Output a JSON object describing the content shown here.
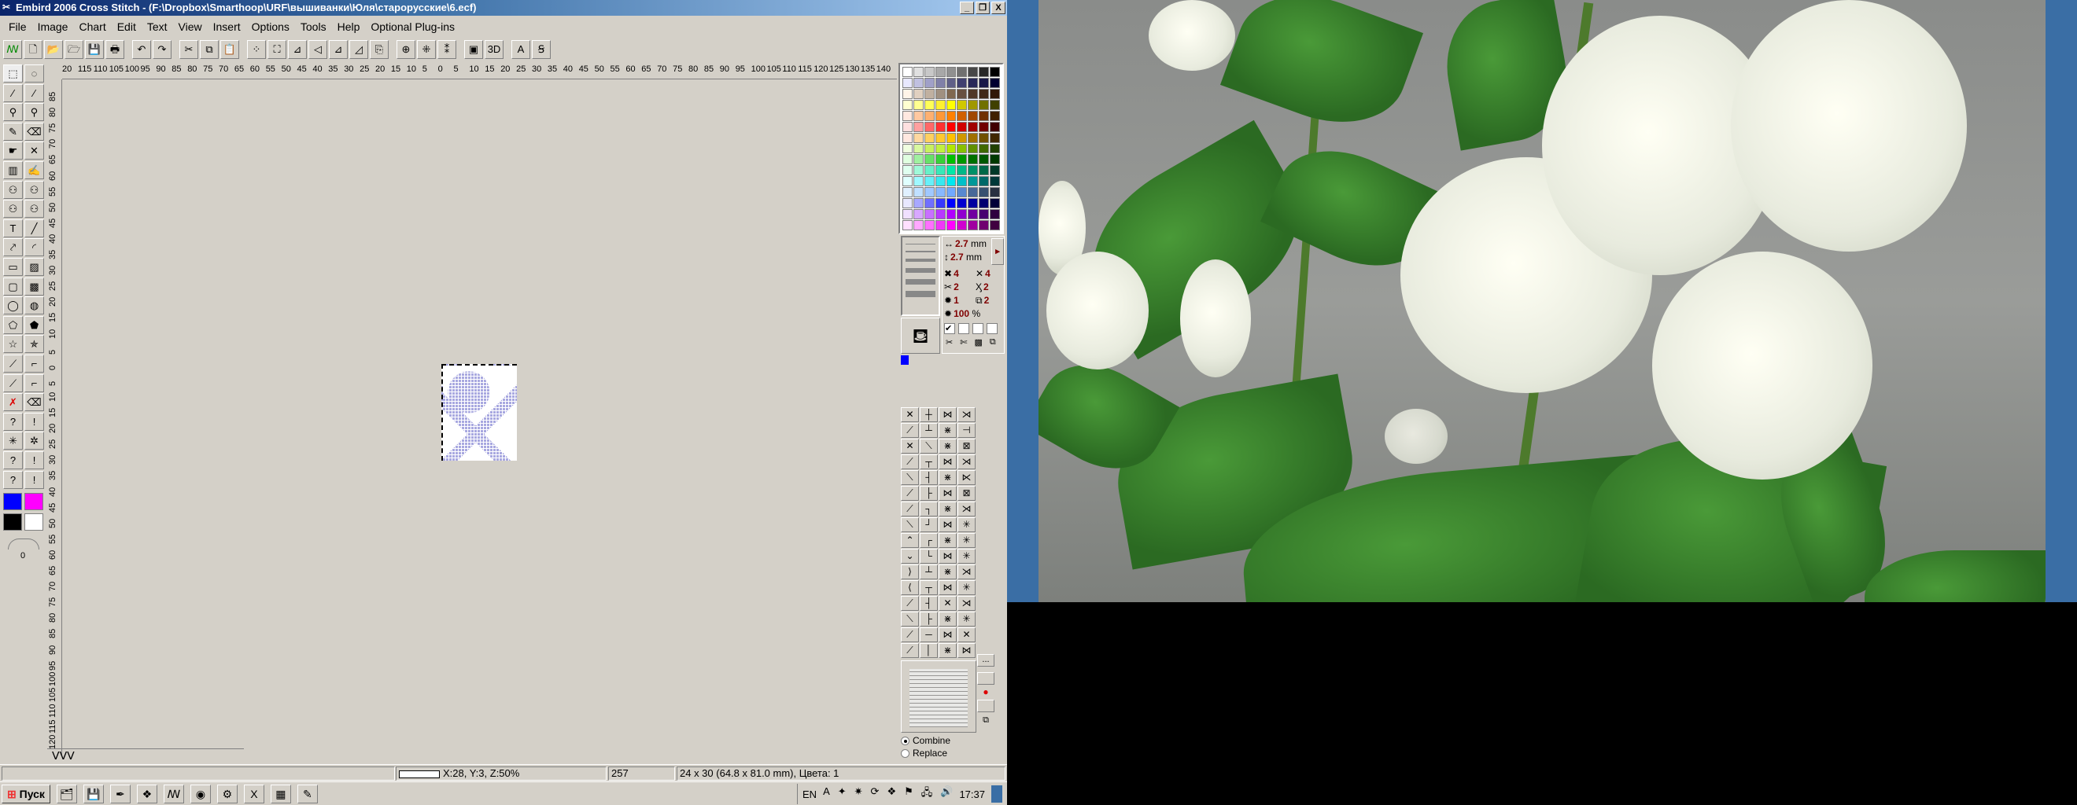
{
  "window": {
    "title": "Embird 2006 Cross Stitch - (F:\\Dropbox\\Smarthoop\\URF\\вышиванки\\Юля\\старорусские\\6.ecf)",
    "buttons": [
      "_",
      "❐",
      "X"
    ]
  },
  "menu": [
    "File",
    "Image",
    "Chart",
    "Edit",
    "Text",
    "View",
    "Insert",
    "Options",
    "Tools",
    "Help",
    "Optional Plug-ins"
  ],
  "toolbar": [
    [
      "embird-logo",
      "ꟿ"
    ],
    [
      "new",
      "🗋"
    ],
    [
      "open",
      "📂"
    ],
    [
      "open-plus",
      "🗁"
    ],
    [
      "save",
      "💾"
    ],
    [
      "print",
      "🖶"
    ],
    [
      "sep",
      ""
    ],
    [
      "undo",
      "↶"
    ],
    [
      "redo",
      "↷"
    ],
    [
      "sep",
      ""
    ],
    [
      "cut",
      "✂"
    ],
    [
      "copy",
      "⧉"
    ],
    [
      "paste",
      "📋"
    ],
    [
      "sep",
      ""
    ],
    [
      "select-area",
      "⁘"
    ],
    [
      "full-view",
      "⛶"
    ],
    [
      "mirror-v",
      "⊿"
    ],
    [
      "mirror-h",
      "◁"
    ],
    [
      "mirror-both",
      "⊿"
    ],
    [
      "rotate",
      "◿"
    ],
    [
      "resize",
      "⎘"
    ],
    [
      "sep",
      ""
    ],
    [
      "center",
      "⊕"
    ],
    [
      "center-v",
      "⁜"
    ],
    [
      "center-h",
      "⁑"
    ],
    [
      "sep",
      ""
    ],
    [
      "preview-2d",
      "▣"
    ],
    [
      "preview-3d",
      "3D"
    ],
    [
      "sep",
      ""
    ],
    [
      "text",
      "A"
    ],
    [
      "text-edit",
      "Ꞩ"
    ]
  ],
  "ruler_top": [
    "20",
    "115",
    "110",
    "105",
    "100",
    "95",
    "90",
    "85",
    "80",
    "75",
    "70",
    "65",
    "60",
    "55",
    "50",
    "45",
    "40",
    "35",
    "30",
    "25",
    "20",
    "15",
    "10",
    "5",
    "0",
    "5",
    "10",
    "15",
    "20",
    "25",
    "30",
    "35",
    "40",
    "45",
    "50",
    "55",
    "60",
    "65",
    "70",
    "75",
    "80",
    "85",
    "90",
    "95",
    "100",
    "105",
    "110",
    "115",
    "120",
    "125",
    "130",
    "135",
    "140"
  ],
  "ruler_left": [
    "85",
    "80",
    "75",
    "70",
    "65",
    "60",
    "55",
    "50",
    "45",
    "40",
    "35",
    "30",
    "25",
    "20",
    "15",
    "10",
    "5",
    "0",
    "5",
    "10",
    "15",
    "20",
    "25",
    "30",
    "35",
    "40",
    "45",
    "50",
    "55",
    "60",
    "65",
    "70",
    "75",
    "80",
    "85",
    "90",
    "95",
    "100",
    "105",
    "110",
    "115",
    "120"
  ],
  "tools": [
    [
      "select-rect",
      "⬚"
    ],
    [
      "select-lasso",
      "◌"
    ],
    [
      "magic-wand",
      "⁄"
    ],
    [
      "magic-wand-2",
      "⁄"
    ],
    [
      "zoom",
      "⚲"
    ],
    [
      "zoom-2",
      "⚲"
    ],
    [
      "pencil",
      "✎"
    ],
    [
      "eraser",
      "⌫"
    ],
    [
      "replace",
      "☛"
    ],
    [
      "spray-erase",
      "✕"
    ],
    [
      "spray",
      "▥"
    ],
    [
      "brush",
      "✍"
    ],
    [
      "pick-1",
      "⚇"
    ],
    [
      "pick-2",
      "⚇"
    ],
    [
      "pick-3",
      "⚇"
    ],
    [
      "pick-4",
      "⚇"
    ],
    [
      "text-tool",
      "T"
    ],
    [
      "line",
      "╱"
    ],
    [
      "eyedropper",
      "⤤"
    ],
    [
      "arc",
      "◜"
    ],
    [
      "rectangle",
      "▭"
    ],
    [
      "rectangle-filled",
      "▨"
    ],
    [
      "rounded-rect",
      "▢"
    ],
    [
      "rounded-rect-filled",
      "▩"
    ],
    [
      "ellipse",
      "◯"
    ],
    [
      "ellipse-filled",
      "◍"
    ],
    [
      "polygon",
      "⬠"
    ],
    [
      "polygon-filled",
      "⬟"
    ],
    [
      "star",
      "☆"
    ],
    [
      "star-filled",
      "✯"
    ],
    [
      "backstitch",
      "⟋"
    ],
    [
      "stairs",
      "⌐"
    ],
    [
      "backstitch-2",
      "⟋"
    ],
    [
      "stairs-2",
      "⌐"
    ],
    [
      "delete-backstitch",
      "✗"
    ],
    [
      "erase-backstitch",
      "⌫"
    ],
    [
      "query-line",
      "?"
    ],
    [
      "mark-line",
      "!"
    ],
    [
      "french-knot",
      "✳"
    ],
    [
      "knot-erase",
      "✲"
    ],
    [
      "query-knot",
      "?"
    ],
    [
      "mark-knot",
      "!"
    ],
    [
      "query-bead",
      "?"
    ],
    [
      "mark-bead",
      "!"
    ]
  ],
  "colors": {
    "primary": "#0000ff",
    "secondary": "#ff00ff",
    "black": "#000000",
    "white": "#ffffff"
  },
  "zoom_value": "0",
  "palette": [
    [
      "#ffffff",
      "#e0e0e0",
      "#c8c8c8",
      "#a8a8a8",
      "#909090",
      "#707070",
      "#484848",
      "#282828",
      "#000000"
    ],
    [
      "#e8e8ff",
      "#c0c0e0",
      "#a0a0c8",
      "#8080a8",
      "#606088",
      "#404070",
      "#282858",
      "#181848",
      "#000030"
    ],
    [
      "#fff4e8",
      "#e0d0c0",
      "#c0b0a0",
      "#a09080",
      "#806850",
      "#685040",
      "#503828",
      "#402818",
      "#301808"
    ],
    [
      "#ffffd0",
      "#ffff90",
      "#ffff58",
      "#fff030",
      "#ffff00",
      "#d0c800",
      "#a09800",
      "#707000",
      "#404000"
    ],
    [
      "#ffe8e0",
      "#ffc8a0",
      "#ffb070",
      "#ff9838",
      "#ff8000",
      "#d06000",
      "#a04800",
      "#703000",
      "#402000"
    ],
    [
      "#ffe0e0",
      "#ffa0a0",
      "#ff6868",
      "#ff3030",
      "#ff0000",
      "#d00000",
      "#a00000",
      "#700000",
      "#400000"
    ],
    [
      "#ffe8e0",
      "#ffd8a0",
      "#ffd060",
      "#ffc830",
      "#ffc000",
      "#d09800",
      "#a07000",
      "#705000",
      "#402800"
    ],
    [
      "#f0ffe0",
      "#d8f8a0",
      "#c8f060",
      "#c0f040",
      "#b0e800",
      "#88c000",
      "#609000",
      "#406800",
      "#204000"
    ],
    [
      "#e0ffe0",
      "#a0f0a0",
      "#68e068",
      "#38d038",
      "#00c000",
      "#009800",
      "#007000",
      "#005800",
      "#003800"
    ],
    [
      "#e0fff0",
      "#a0f8d8",
      "#68f0c8",
      "#38e8b8",
      "#00e8a8",
      "#00b888",
      "#009068",
      "#006848",
      "#003828"
    ],
    [
      "#e0ffff",
      "#a0f8ff",
      "#68f0f8",
      "#38e8f0",
      "#00e8f0",
      "#00c0c8",
      "#009898",
      "#006868",
      "#003838"
    ],
    [
      "#e0f0ff",
      "#c0e0ff",
      "#a0c8ff",
      "#88b8ff",
      "#70a8ff",
      "#5888d0",
      "#486898",
      "#385070",
      "#283040"
    ],
    [
      "#e8e8ff",
      "#a8a8ff",
      "#7070ff",
      "#3838ff",
      "#0000ff",
      "#0000d0",
      "#0000a0",
      "#000070",
      "#000038"
    ],
    [
      "#f0e0ff",
      "#d8a8ff",
      "#c870ff",
      "#b838ff",
      "#b000ff",
      "#9000d0",
      "#7000a0",
      "#480070",
      "#300040"
    ],
    [
      "#ffe0ff",
      "#ffa8ff",
      "#ff70ff",
      "#f038f8",
      "#ff00ff",
      "#d000d0",
      "#a000a0",
      "#700070",
      "#400040"
    ]
  ],
  "info": {
    "width_val": "2.7",
    "width_unit": "mm",
    "height_val": "2.7",
    "height_unit": "mm",
    "full_cross": "4",
    "half_cross": "4",
    "quarter": "2",
    "three_quarter": "2",
    "knots": "1",
    "layers": "2",
    "scale_val": "100",
    "scale_unit": "%"
  },
  "stitches": [
    "✕",
    "┼",
    "⋈",
    "⋊",
    "⟋",
    "┴",
    "⋇",
    "⊣",
    "✕",
    "⟍",
    "⋇",
    "⊠",
    "⟋",
    "┬",
    "⋈",
    "⋊",
    "⟍",
    "┤",
    "⋇",
    "⋉",
    "⟋",
    "├",
    "⋈",
    "⊠",
    "⟋",
    "┐",
    "⋇",
    "⋊",
    "⟍",
    "┘",
    "⋈",
    "✳",
    "⌃",
    "┌",
    "⋇",
    "✳",
    "⌄",
    "└",
    "⋈",
    "✳",
    "⟩",
    "┴",
    "⋇",
    "⋊",
    "⟨",
    "┬",
    "⋈",
    "✳",
    "⟋",
    "┤",
    "✕",
    "⋊",
    "⟍",
    "├",
    "⋇",
    "✳",
    "⟋",
    "─",
    "⋈",
    "✕",
    "⟋",
    "│",
    "⋇",
    "⋈"
  ],
  "side_buttons": [
    "...",
    "",
    ""
  ],
  "radio": {
    "combine": "Combine",
    "replace": "Replace"
  },
  "status": {
    "coords": "X:28, Y:3, Z:50%",
    "count": "257",
    "size": "24 x 30 (64.8 x 81.0 mm), Цвета: 1"
  },
  "taskbar": {
    "start": "Пуск",
    "apps": [
      [
        "explorer",
        "🗂"
      ],
      [
        "save-app",
        "💾"
      ],
      [
        "feather",
        "✒"
      ],
      [
        "dropbox",
        "❖"
      ],
      [
        "embird",
        "ꟿ"
      ],
      [
        "chrome",
        "◉"
      ],
      [
        "sewing",
        "⚙"
      ],
      [
        "excel",
        "X"
      ],
      [
        "calculator",
        "▦"
      ],
      [
        "paint",
        "✎"
      ]
    ],
    "lang": "EN",
    "tray": [
      [
        "acrobat",
        "A"
      ],
      [
        "notify",
        "✦"
      ],
      [
        "virus",
        "✷"
      ],
      [
        "update",
        "⟳"
      ],
      [
        "dropbox-tray",
        "❖"
      ],
      [
        "flag",
        "⚑"
      ],
      [
        "network",
        "🖧"
      ],
      [
        "volume",
        "🔊"
      ]
    ],
    "clock": "17:37"
  }
}
